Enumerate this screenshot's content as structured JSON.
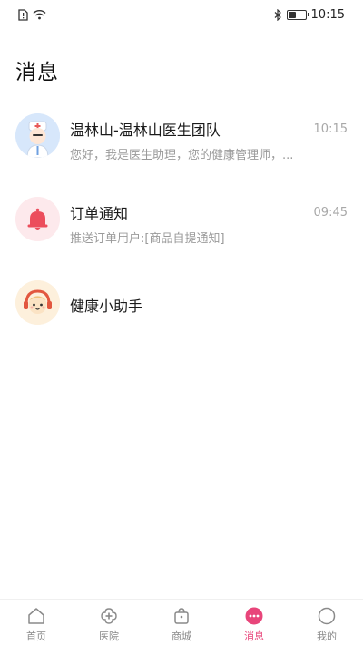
{
  "status_bar": {
    "time": "10:15",
    "battery_level_percent": 45
  },
  "page": {
    "title": "消息"
  },
  "conversations": [
    {
      "name": "温林山-温林山医生团队",
      "time": "10:15",
      "preview": "您好，我是医生助理，您的健康管理师，...",
      "avatar_icon": "doctor-avatar-icon"
    },
    {
      "name": "订单通知",
      "time": "09:45",
      "preview": "推送订单用户:[商品自提通知]",
      "avatar_icon": "bell-icon"
    },
    {
      "name": "健康小助手",
      "time": "",
      "preview": "",
      "avatar_icon": "assistant-avatar-icon"
    }
  ],
  "tabbar": {
    "active_color": "#e8457a",
    "tabs": [
      {
        "label": "首页",
        "icon": "home-icon"
      },
      {
        "label": "医院",
        "icon": "hospital-icon"
      },
      {
        "label": "商城",
        "icon": "shop-bag-icon"
      },
      {
        "label": "消息",
        "icon": "message-icon",
        "active": true
      },
      {
        "label": "我的",
        "icon": "profile-icon"
      }
    ]
  }
}
